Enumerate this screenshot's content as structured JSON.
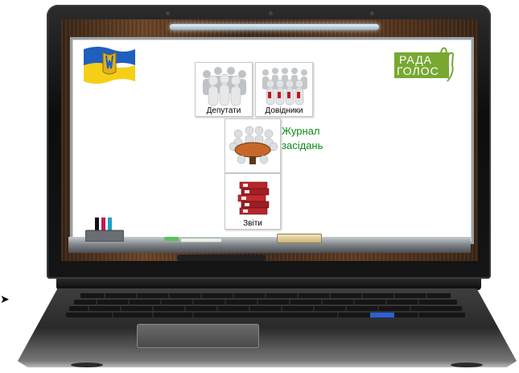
{
  "app": {
    "title": "Рада Голос"
  },
  "logo": {
    "line1": "РАДА",
    "line2": "ГОЛОС",
    "color": "#78a832"
  },
  "menu": {
    "deputies": {
      "label": "Депутати",
      "icon": "people-group-icon"
    },
    "references": {
      "label": "Довідники",
      "icon": "people-crowd-icon"
    },
    "journal": {
      "line1": "Журнал",
      "line2": "засідань",
      "icon": "meeting-table-icon"
    },
    "reports": {
      "label": "Звіти",
      "icon": "binders-stack-icon"
    }
  },
  "pointer": {
    "glyph": "➤"
  },
  "colors": {
    "journal_text": "#0a8a16",
    "flag_blue": "#1f5fbf",
    "flag_yellow": "#f5cf16",
    "wood": "#5a3a1e"
  }
}
